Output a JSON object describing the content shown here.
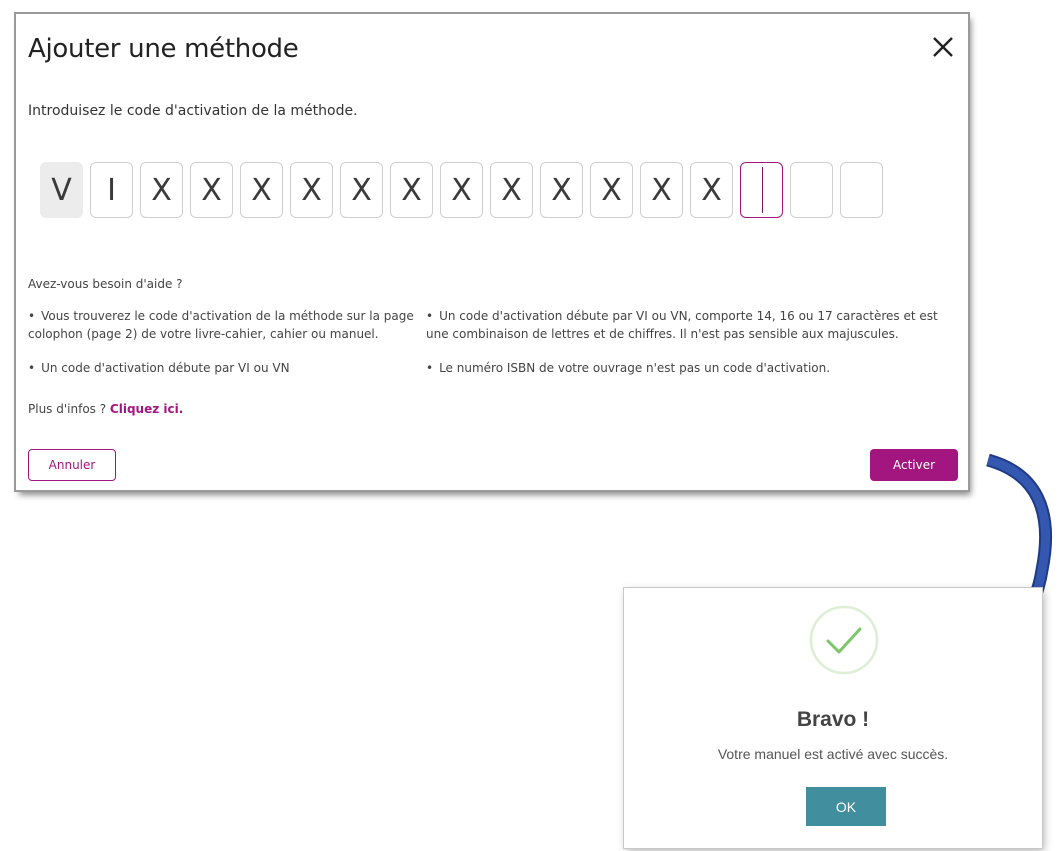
{
  "modal": {
    "title": "Ajouter une méthode",
    "instruction": "Introduisez le code d'activation de la méthode.",
    "code_chars": [
      "V",
      "I",
      "X",
      "X",
      "X",
      "X",
      "X",
      "X",
      "X",
      "X",
      "X",
      "X",
      "X",
      "X",
      "",
      "",
      ""
    ],
    "help_title": "Avez-vous besoin d'aide ?",
    "help_items": [
      "Vous trouverez le code d'activation de la méthode sur la page colophon (page 2) de votre livre-cahier, cahier ou manuel.",
      "Un code d'activation débute par VI ou VN, comporte 14, 16 ou 17 caractères et est une combinaison de lettres et de chiffres. Il n'est pas sensible aux majuscules.",
      "Un code d'activation débute par VI ou VN",
      "Le numéro ISBN de votre ouvrage n'est pas un code d'activation."
    ],
    "more_info_prefix": "Plus d'infos ? ",
    "more_info_link": "Cliquez ici.",
    "cancel_label": "Annuler",
    "activate_label": "Activer",
    "accent_color": "#a3167f"
  },
  "success": {
    "title": "Bravo !",
    "message": "Votre manuel est activé avec succès.",
    "ok_label": "OK",
    "icon": "check-circle-icon",
    "button_color": "#418f9e"
  },
  "arrow": {
    "icon": "curved-arrow-icon",
    "color": "#2f4fa2"
  }
}
